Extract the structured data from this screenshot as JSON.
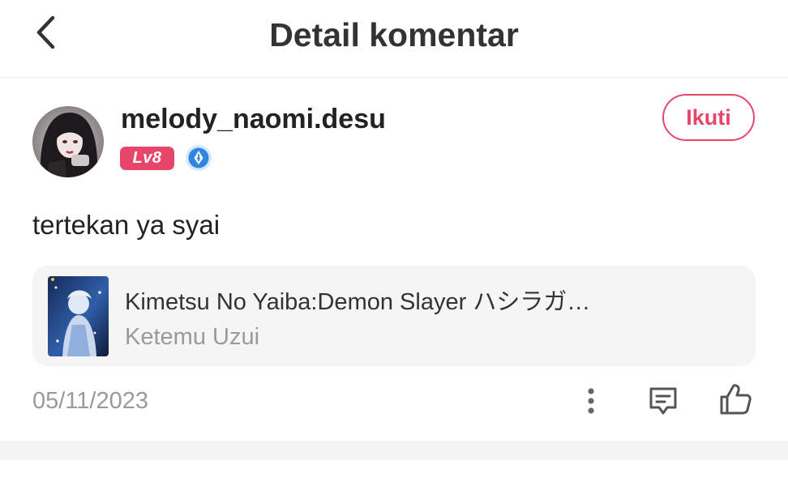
{
  "header": {
    "title": "Detail komentar",
    "back_icon": "chevron-left-icon"
  },
  "user": {
    "username": "melody_naomi.desu",
    "level_badge": "Lv8",
    "level_color": "#e8456b",
    "creator_badge_icon": "quill-pen-badge-icon",
    "follow_label": "Ikuti"
  },
  "comment": {
    "text": "tertekan ya syai"
  },
  "reference": {
    "title": "Kimetsu No Yaiba:Demon Slayer ハシラガ…",
    "subtitle": "Ketemu Uzui"
  },
  "meta": {
    "date": "05/11/2023"
  },
  "actions": {
    "more_icon": "more-vertical-icon",
    "reply_icon": "comment-icon",
    "like_icon": "thumbs-up-icon"
  },
  "colors": {
    "accent": "#e8456b",
    "text_primary": "#222222",
    "text_secondary": "#9a9a9a",
    "card_background": "#f5f5f5"
  }
}
